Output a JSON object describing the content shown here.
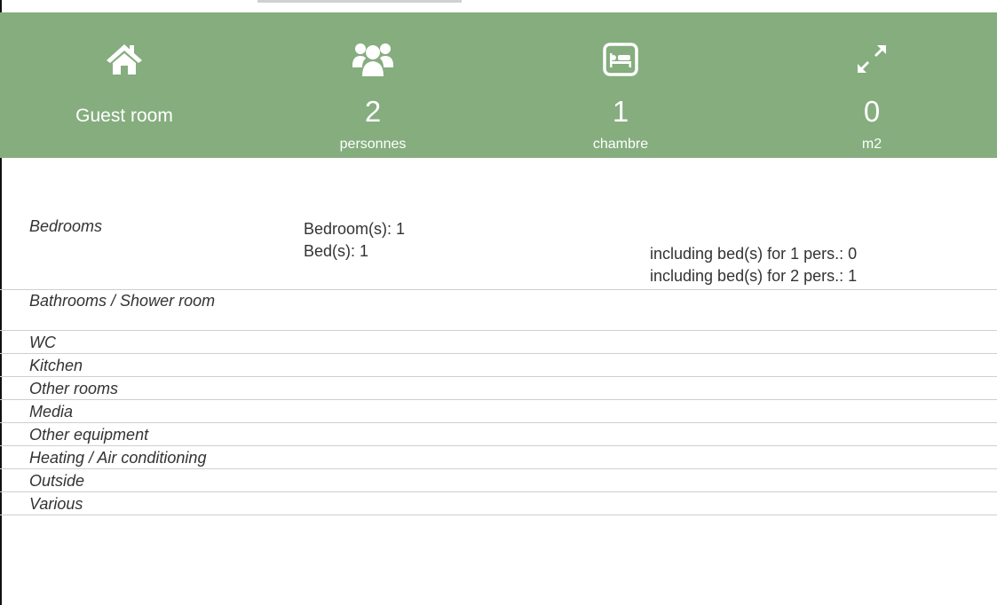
{
  "summary": {
    "type_label": "Guest room",
    "persons": {
      "value": "2",
      "unit": "personnes"
    },
    "rooms": {
      "value": "1",
      "unit": "chambre"
    },
    "area": {
      "value": "0",
      "unit": "m2"
    }
  },
  "bedrooms": {
    "label": "Bedrooms",
    "bedroom_count": "Bedroom(s): 1",
    "bed_count": "Bed(s):  1",
    "single_beds": "including bed(s) for 1 pers.: 0",
    "double_beds": "including bed(s) for 2 pers.: 1"
  },
  "categories": [
    "Bathrooms / Shower room",
    "WC",
    "Kitchen",
    "Other rooms",
    "Media",
    "Other equipment",
    "Heating / Air conditioning",
    "Outside",
    "Various"
  ],
  "colors": {
    "banner": "#85ad7e",
    "text": "#333333"
  }
}
